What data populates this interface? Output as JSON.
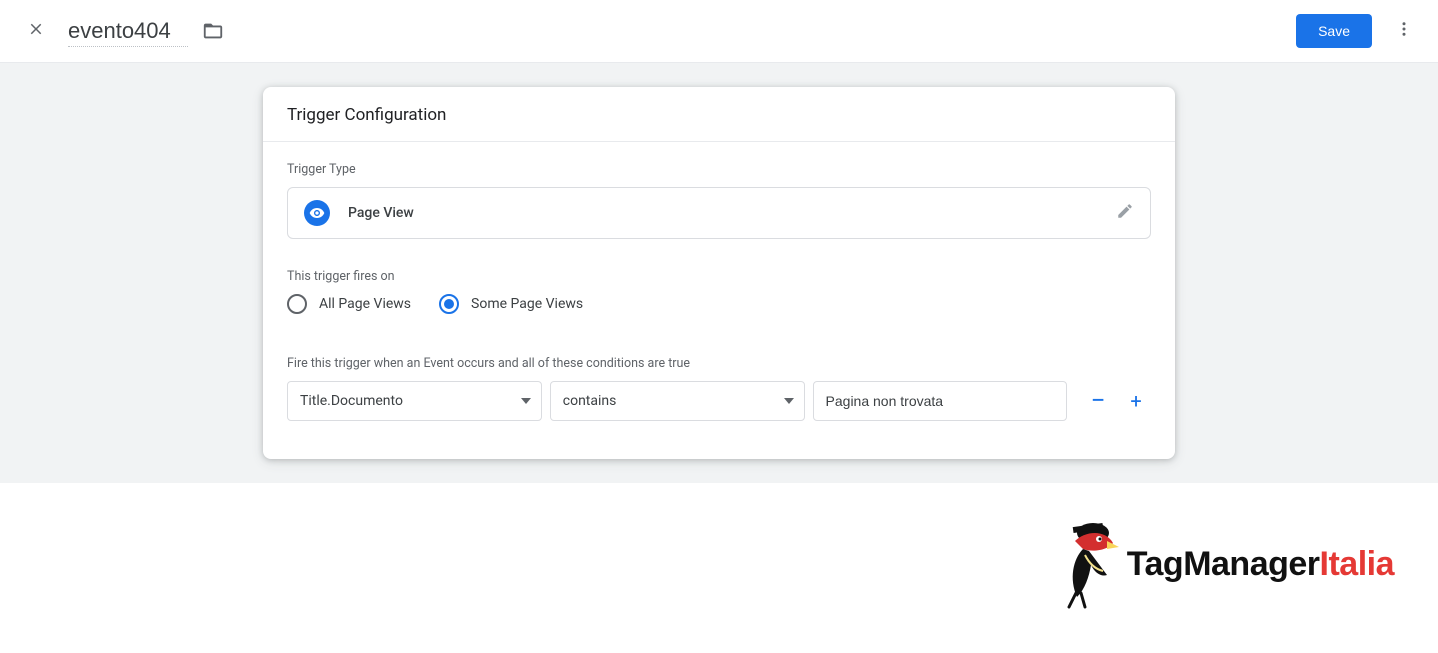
{
  "header": {
    "trigger_name": "evento404",
    "save_label": "Save"
  },
  "card": {
    "title": "Trigger Configuration",
    "trigger_type_label": "Trigger Type",
    "trigger_type_value": "Page View",
    "fires_on_label": "This trigger fires on",
    "radio_all_label": "All Page Views",
    "radio_some_label": "Some Page Views",
    "radio_selected": "some",
    "condition_desc": "Fire this trigger when an Event occurs and all of these conditions are true",
    "condition": {
      "variable": "Title.Documento",
      "operator": "contains",
      "value": "Pagina non trovata"
    }
  },
  "footer": {
    "logo_tag": "TagManager",
    "logo_italia": "Italia"
  }
}
